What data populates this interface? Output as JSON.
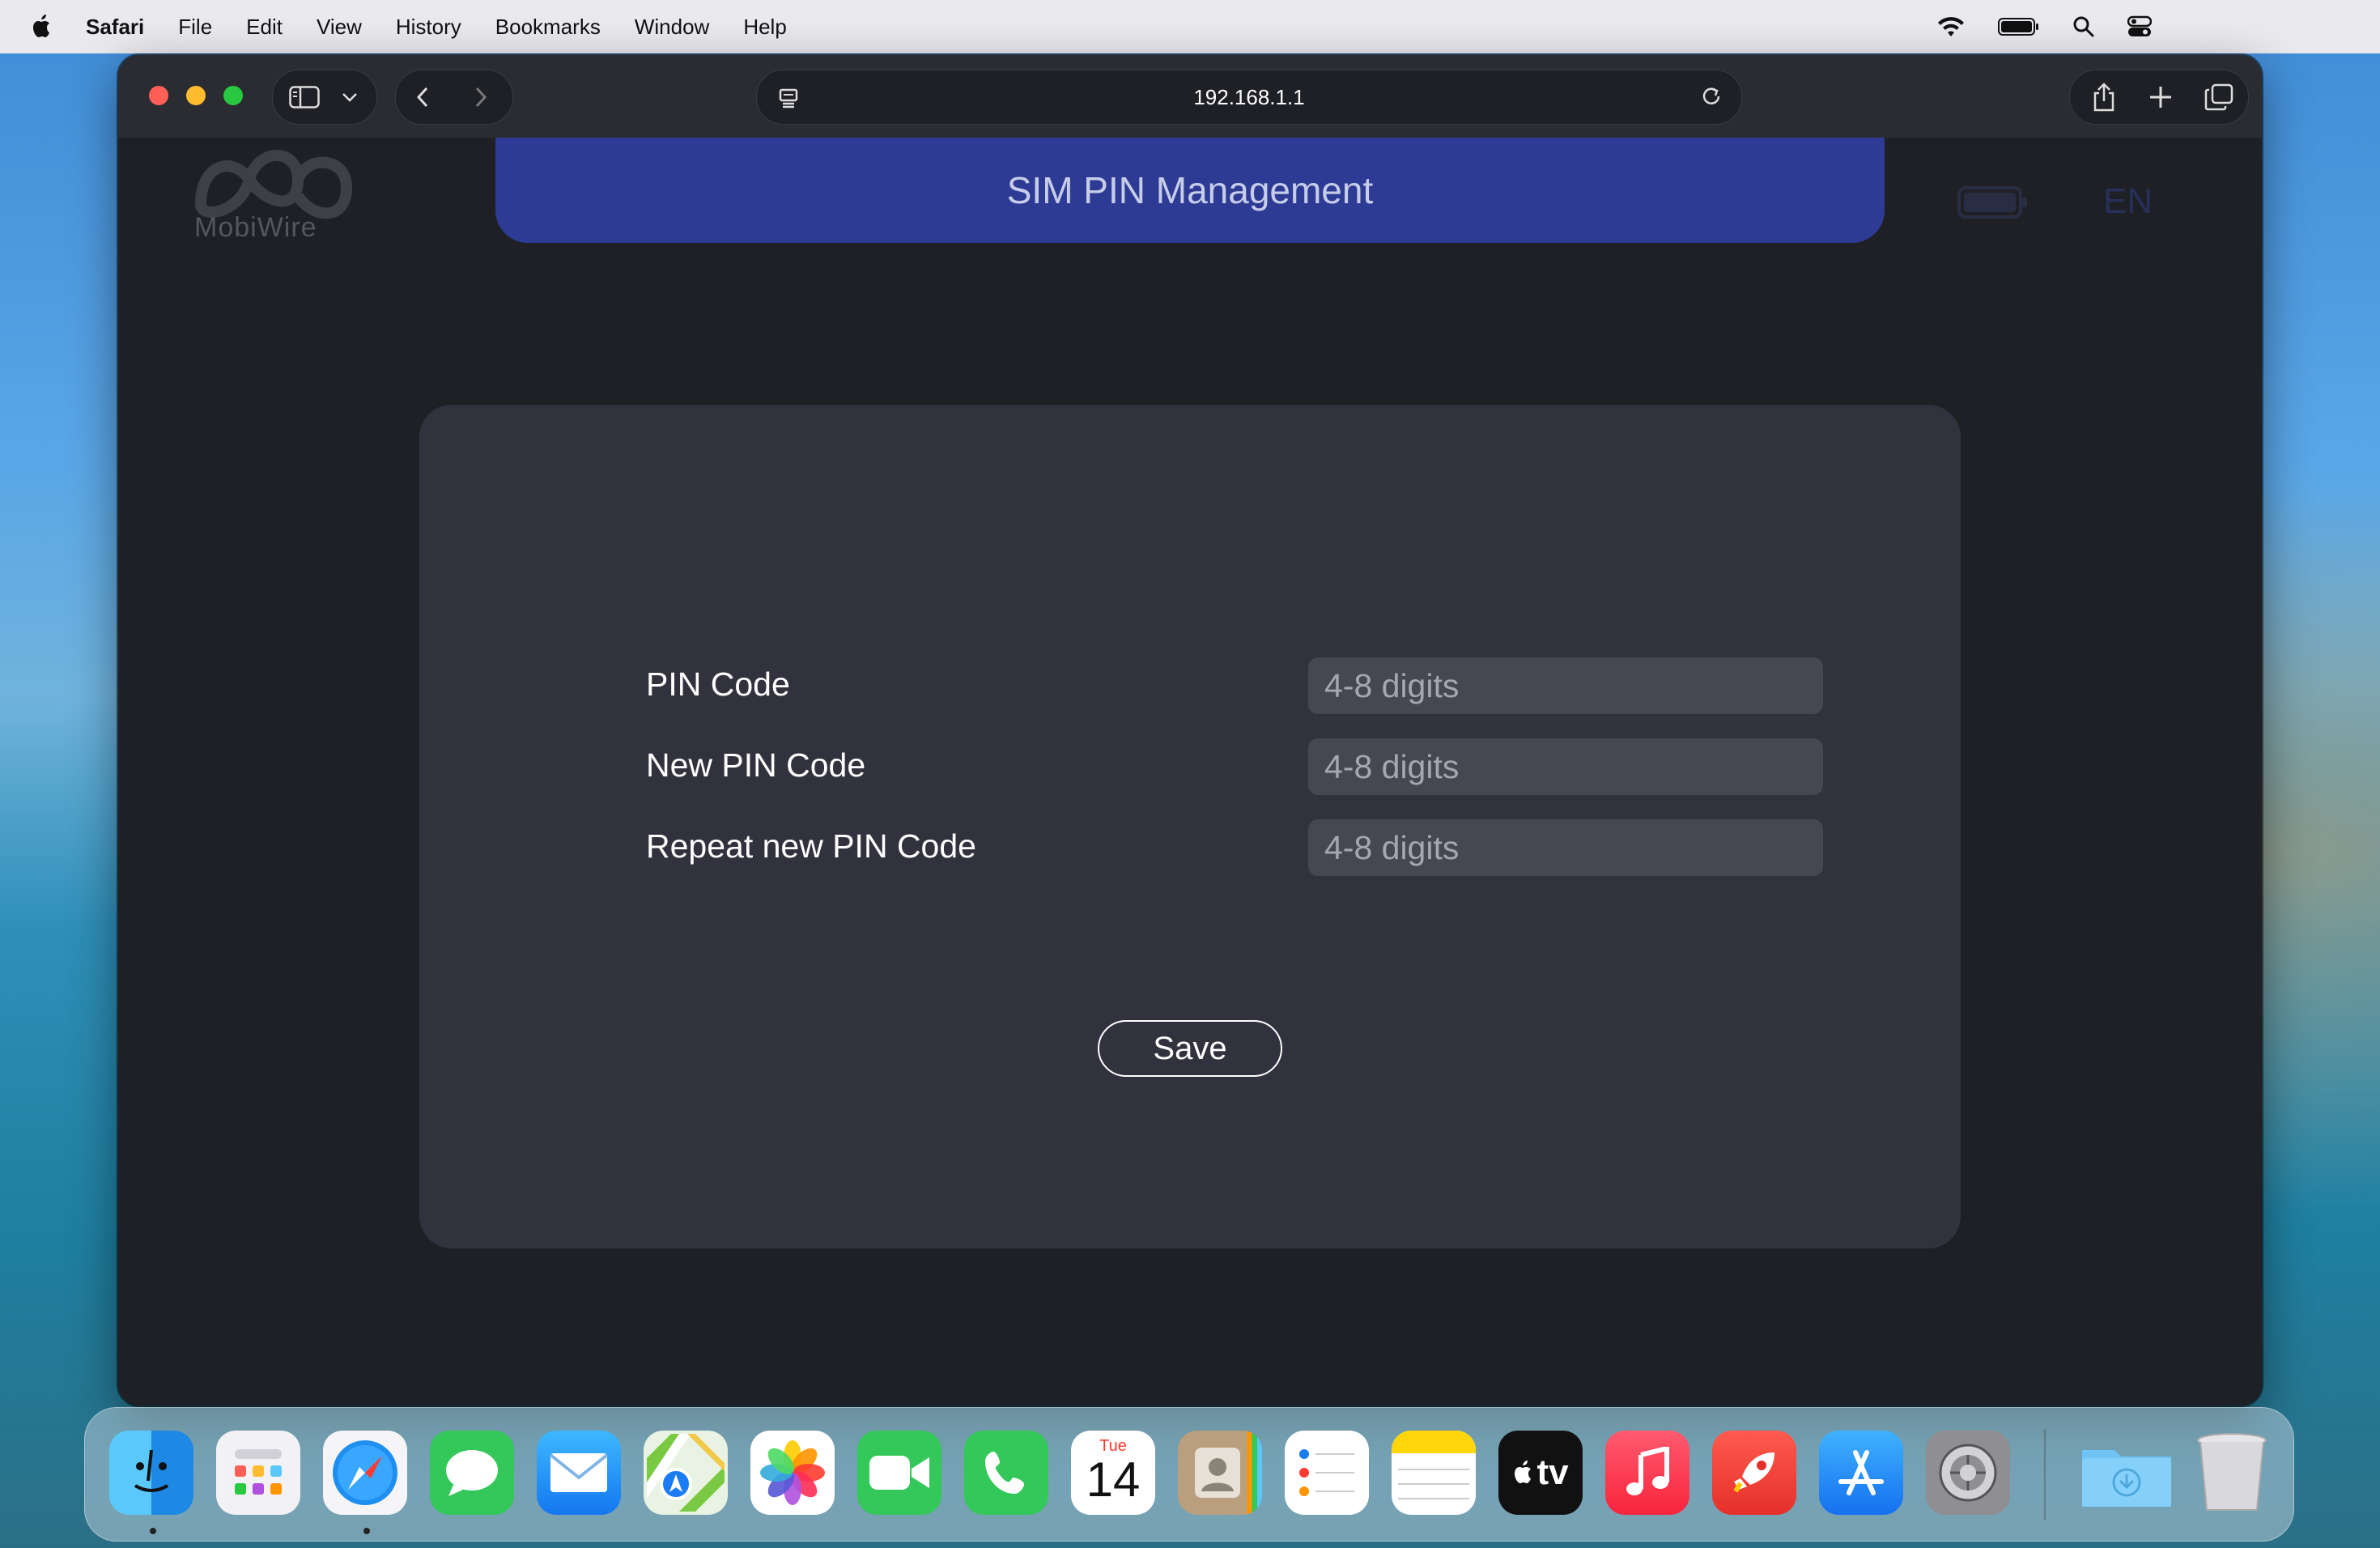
{
  "menubar": {
    "app_name": "Safari",
    "items": [
      "File",
      "Edit",
      "View",
      "History",
      "Bookmarks",
      "Window",
      "Help"
    ],
    "status_icons": [
      "wifi-icon",
      "battery-icon",
      "search-icon",
      "control-center-icon"
    ]
  },
  "browser": {
    "url": "192.168.1.1",
    "toolbar_icons": [
      "sidebar-icon",
      "chevron-down-icon",
      "back-icon",
      "forward-icon",
      "site-settings-icon",
      "reload-icon",
      "share-icon",
      "new-tab-icon",
      "tab-overview-icon"
    ]
  },
  "page": {
    "logo_text": "MobiWire",
    "banner_title": "SIM PIN Management",
    "lang": "EN",
    "form": {
      "fields": [
        {
          "label": "PIN Code",
          "placeholder": "4-8 digits"
        },
        {
          "label": "New PIN Code",
          "placeholder": "4-8 digits"
        },
        {
          "label": "Repeat new PIN Code",
          "placeholder": "4-8 digits"
        }
      ],
      "save_label": "Save"
    }
  },
  "dock": {
    "apps": [
      "Finder",
      "Launchpad",
      "Safari",
      "Messages",
      "Mail",
      "Maps",
      "Photos",
      "FaceTime",
      "Phone",
      "Calendar",
      "Contacts",
      "Reminders",
      "Notes",
      "TV",
      "Music",
      "Rocket",
      "App Store",
      "System Settings",
      "Downloads",
      "Trash"
    ],
    "calendar": {
      "day": "Tue",
      "date": "14"
    },
    "tv_label": "tv"
  },
  "colors": {
    "banner": "#2d3b94",
    "card": "#31323d",
    "page_bg": "#1f2025"
  }
}
